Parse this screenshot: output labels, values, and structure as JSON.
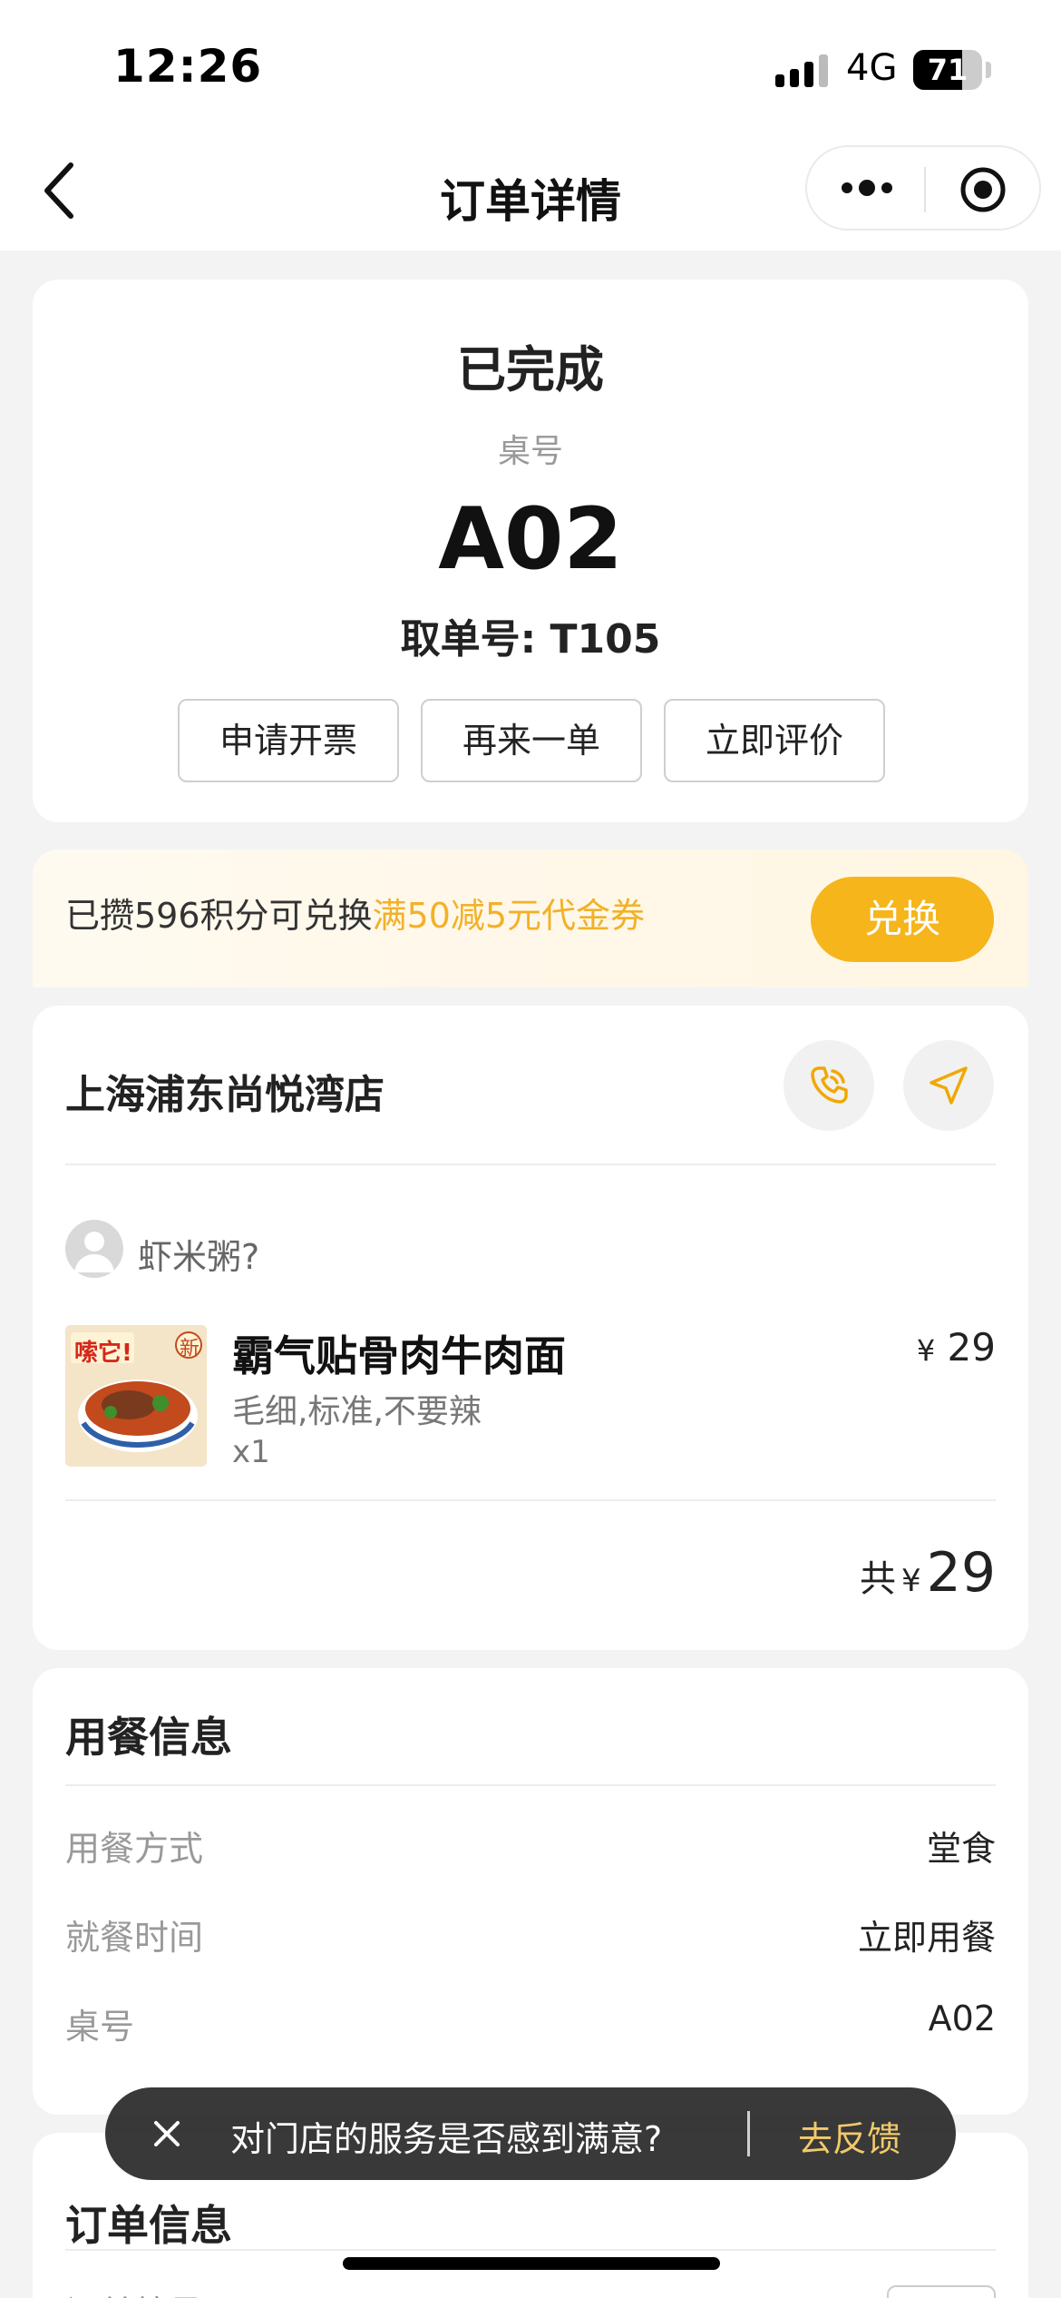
{
  "status_bar": {
    "time": "12:26",
    "network": "4G",
    "battery": "71",
    "battery_level": 0.71
  },
  "nav": {
    "title": "订单详情",
    "back_icon": "chevron-left-icon",
    "more_icon": "more-dots-icon",
    "close_icon": "target-circle-icon"
  },
  "order": {
    "status": "已完成",
    "table_label": "桌号",
    "table_no": "A02",
    "pickup": "取单号: T105",
    "actions": [
      "申请开票",
      "再来一单",
      "立即评价"
    ]
  },
  "points": {
    "text_prefix": "已攒596积分可兑换",
    "text_highlight": "满50减5元代金券",
    "button": "兑换",
    "highlight_color": "#f2b12a",
    "button_color": "#f5b51b"
  },
  "store": {
    "name": "上海浦东尚悦湾店",
    "phone_icon": "phone-icon",
    "navigate_icon": "navigate-arrow-icon",
    "user_name": "虾米粥?",
    "item": {
      "name": "霸气贴骨肉牛肉面",
      "spec": "毛细,标准,不要辣",
      "qty": "x1",
      "currency": "¥",
      "price": "29",
      "image_badge": "嗦它!",
      "image_tag": "新"
    },
    "total_label": "共",
    "total_currency": "¥",
    "total_amount": "29"
  },
  "meal_info": {
    "title": "用餐信息",
    "rows": [
      {
        "key": "用餐方式",
        "value": "堂食"
      },
      {
        "key": "就餐时间",
        "value": "立即用餐"
      },
      {
        "key": "桌号",
        "value": "A02"
      }
    ]
  },
  "order_info": {
    "title": "订单信息",
    "partial_row": "订单编号"
  },
  "toast": {
    "text": "对门店的服务是否感到满意?",
    "link": "去反馈"
  }
}
